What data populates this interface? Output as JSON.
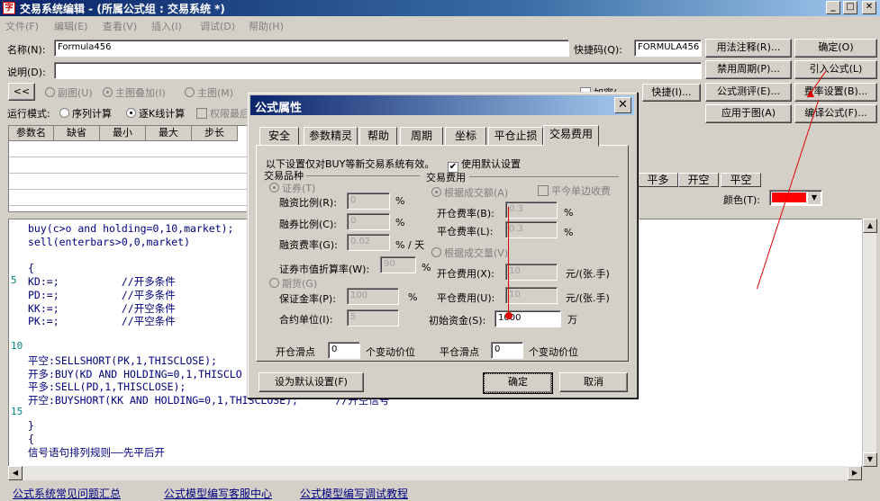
{
  "window": {
    "title": "交易系统编辑 - (所属公式组 : 交易系统 *)"
  },
  "menu": [
    "文件(F)",
    "编辑(E)",
    "查看(V)",
    "插入(I)",
    "调试(D)",
    "帮助(H)"
  ],
  "form": {
    "name_label": "名称(N):",
    "name_value": "Formula456",
    "shortcut_label": "快捷码(Q):",
    "shortcut_value": "FORMULA456",
    "desc_label": "说明(D):",
    "desc_value": "",
    "back_btn": "<<",
    "view_opts": [
      "副图(U)",
      "主图叠加(I)",
      "主图(M)"
    ],
    "add_label": "加密(",
    "quick_btn": "快捷(I)..."
  },
  "run_mode": {
    "label": "运行模式:",
    "opt1": "序列计算",
    "opt2": "逐K线计算",
    "opt3": "权限最后"
  },
  "right_buttons": [
    "用法注释(R)...",
    "确定(O)",
    "禁用周期(P)...",
    "引入公式(L)",
    "公式测评(E)...",
    "费率设置(B)...",
    "应用于图(A)",
    "编译公式(F)..."
  ],
  "grid": {
    "headers": [
      "参数名",
      "缺省",
      "最小",
      "最大",
      "步长"
    ]
  },
  "signal_tabs": [
    "平多",
    "开空",
    "平空"
  ],
  "color_label": "颜色(T):",
  "color_value": "#ff0000",
  "editor": {
    "lines": [
      {
        "n": "",
        "t": "buy(c>o and holding=0,10,market);"
      },
      {
        "n": "",
        "t": "sell(enterbars>0,0,market)"
      },
      {
        "n": "",
        "t": ""
      },
      {
        "n": "",
        "t": "{"
      },
      {
        "n": "5",
        "t": "KD:=;          //开多条件"
      },
      {
        "n": "",
        "t": "PD:=;          //平多条件"
      },
      {
        "n": "",
        "t": "KK:=;          //开空条件"
      },
      {
        "n": "",
        "t": "PK:=;          //平空条件"
      },
      {
        "n": "",
        "t": ""
      },
      {
        "n": "10",
        "t": ""
      },
      {
        "n": "",
        "t": "平空:SELLSHORT(PK,1,THISCLOSE);"
      },
      {
        "n": "",
        "t": "开多:BUY(KD AND HOLDING=0,1,THISCLO"
      },
      {
        "n": "",
        "t": "平多:SELL(PD,1,THISCLOSE);"
      },
      {
        "n": "",
        "t": "开空:BUYSHORT(KK AND HOLDING=0,1,THISCLOSE);      //开空信号"
      },
      {
        "n": "15",
        "t": ""
      },
      {
        "n": "",
        "t": "}"
      },
      {
        "n": "",
        "t": "{"
      },
      {
        "n": "",
        "t": "信号语句排列规则——先平后开"
      }
    ]
  },
  "links": [
    "公式系统常见问题汇总",
    "公式模型编写客服中心",
    "公式模型编写调试教程"
  ],
  "dialog": {
    "title": "公式属性",
    "tabs": [
      "安全",
      "参数精灵",
      "帮助",
      "周期",
      "坐标",
      "平仓止损",
      "交易费用"
    ],
    "notice": "以下设置仅对BUY等新交易系统有效。",
    "use_default": "使用默认设置",
    "group_variety": "交易品种",
    "group_fee": "交易费用",
    "securities": "证券(T)",
    "margin_ratio_label": "融资比例(R):",
    "margin_ratio_value": "0",
    "short_ratio_label": "融券比例(C):",
    "short_ratio_value": "0",
    "margin_fee_label": "融资费率(G):",
    "margin_fee_value": "0.02",
    "pct": "%",
    "pct_day": "% / 天",
    "market_value_label": "证券市值折算率(W):",
    "market_value_value": "90",
    "futures": "期货(G)",
    "deposit_label": "保证金率(P):",
    "deposit_value": "100",
    "unit_label": "合约单位(I):",
    "unit_value": "5",
    "by_amount": "根据成交额(A)",
    "close_today": "平今单边收费",
    "open_rate_label": "开仓费率(B):",
    "open_rate_value": "0.3",
    "close_rate_label": "平仓费率(L):",
    "close_rate_value": "0.3",
    "by_volume": "根据成交量(V)",
    "open_fee_label": "开仓费用(X):",
    "open_fee_value": "10",
    "close_fee_label": "平仓费用(U):",
    "close_fee_value": "10",
    "fee_unit": "元/(张.手)",
    "initial_label": "初始资金(S):",
    "initial_value": "1000",
    "wan": "万",
    "open_slip_label": "开仓滑点",
    "open_slip_value": "0",
    "close_slip_label": "平仓滑点",
    "close_slip_value": "0",
    "tick_unit": "个变动价位",
    "set_default_btn": "设为默认设置(F)",
    "ok_btn": "确定",
    "cancel_btn": "取消"
  }
}
